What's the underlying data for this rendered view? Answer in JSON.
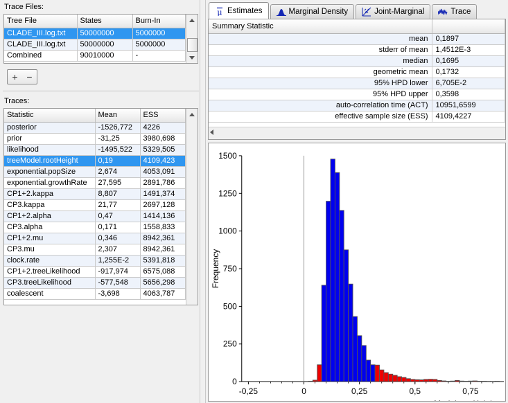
{
  "left_panel": {
    "trace_files_label": "Trace Files:",
    "trace_files_table": {
      "columns": [
        "Tree File",
        "States",
        "Burn-In"
      ],
      "rows": [
        {
          "file": "CLADE_III.log.txt",
          "states": "50000000",
          "burnin": "5000000",
          "selected": true
        },
        {
          "file": "CLADE_III.log.txt",
          "states": "50000000",
          "burnin": "5000000",
          "selected": false
        },
        {
          "file": "Combined",
          "states": "90010000",
          "burnin": "-",
          "selected": false
        }
      ]
    },
    "add_button_label": "+",
    "remove_button_label": "−",
    "traces_label": "Traces:",
    "traces_table": {
      "columns": [
        "Statistic",
        "Mean",
        "ESS"
      ],
      "rows": [
        {
          "statistic": "posterior",
          "mean": "-1526,772",
          "ess": "4226",
          "selected": false
        },
        {
          "statistic": "prior",
          "mean": "-31,25",
          "ess": "3980,698",
          "selected": false
        },
        {
          "statistic": "likelihood",
          "mean": "-1495,522",
          "ess": "5329,505",
          "selected": false
        },
        {
          "statistic": "treeModel.rootHeight",
          "mean": "0,19",
          "ess": "4109,423",
          "selected": true
        },
        {
          "statistic": "exponential.popSize",
          "mean": "2,674",
          "ess": "4053,091",
          "selected": false
        },
        {
          "statistic": "exponential.growthRate",
          "mean": "27,595",
          "ess": "2891,786",
          "selected": false
        },
        {
          "statistic": "CP1+2.kappa",
          "mean": "8,807",
          "ess": "1491,374",
          "selected": false
        },
        {
          "statistic": "CP3.kappa",
          "mean": "21,77",
          "ess": "2697,128",
          "selected": false
        },
        {
          "statistic": "CP1+2.alpha",
          "mean": "0,47",
          "ess": "1414,136",
          "selected": false
        },
        {
          "statistic": "CP3.alpha",
          "mean": "0,171",
          "ess": "1558,833",
          "selected": false
        },
        {
          "statistic": "CP1+2.mu",
          "mean": "0,346",
          "ess": "8942,361",
          "selected": false
        },
        {
          "statistic": "CP3.mu",
          "mean": "2,307",
          "ess": "8942,361",
          "selected": false
        },
        {
          "statistic": "clock.rate",
          "mean": "1,255E-2",
          "ess": "5391,818",
          "selected": false
        },
        {
          "statistic": "CP1+2.treeLikelihood",
          "mean": "-917,974",
          "ess": "6575,088",
          "selected": false
        },
        {
          "statistic": "CP3.treeLikelihood",
          "mean": "-577,548",
          "ess": "5656,298",
          "selected": false
        },
        {
          "statistic": "coalescent",
          "mean": "-3,698",
          "ess": "4063,787",
          "selected": false
        }
      ]
    }
  },
  "right_panel": {
    "tabs": [
      {
        "label": "Estimates",
        "icon": "mu-bar-icon",
        "active": true
      },
      {
        "label": "Marginal Density",
        "icon": "density-curve-icon",
        "active": false
      },
      {
        "label": "Joint-Marginal",
        "icon": "scatter-diagonal-icon",
        "active": false
      },
      {
        "label": "Trace",
        "icon": "trace-wave-icon",
        "active": false
      }
    ],
    "summary": {
      "header": "Summary Statistic",
      "header_value": "",
      "rows": [
        {
          "key": "mean",
          "value": "0,1897"
        },
        {
          "key": "stderr of mean",
          "value": "1,4512E-3"
        },
        {
          "key": "median",
          "value": "0,1695"
        },
        {
          "key": "geometric mean",
          "value": "0,1732"
        },
        {
          "key": "95% HPD lower",
          "value": "6,705E-2"
        },
        {
          "key": "95% HPD upper",
          "value": "0,3598"
        },
        {
          "key": "auto-correlation time (ACT)",
          "value": "10951,6599"
        },
        {
          "key": "effective sample size (ESS)",
          "value": "4109,4227"
        }
      ]
    }
  },
  "colors": {
    "selection_blue": "#2f96f0",
    "bar_blue": "#0000ee",
    "bar_red": "#ee0000",
    "bar_outline": "#555555",
    "tab_icon_blue": "#1427b4"
  },
  "chart_data": {
    "type": "bar",
    "title": "",
    "xlabel": "treeModel.rootHeight",
    "ylabel": "Frequency",
    "xlim": [
      -0.28,
      0.9
    ],
    "ylim": [
      0,
      1500
    ],
    "xticks": [
      -0.25,
      0,
      0.25,
      0.5,
      0.75
    ],
    "xticklabels": [
      "-0,25",
      "0",
      "0,25",
      "0,5",
      "0,75"
    ],
    "yticks": [
      0,
      250,
      500,
      750,
      1000,
      1250,
      1500
    ],
    "yticklabels": [
      "0",
      "250",
      "500",
      "750",
      "1000",
      "1250",
      "1500"
    ],
    "grid": false,
    "legend": false,
    "vertical_reference_line_x": 0,
    "bin_width": 0.02,
    "hpd_lower": 0.06705,
    "hpd_upper": 0.3598,
    "bar_colors": {
      "inside_hpd": "#0000ee",
      "outside_hpd": "#ee0000"
    },
    "bins": [
      {
        "x0": 0.02,
        "value": 3,
        "color": "red"
      },
      {
        "x0": 0.04,
        "value": 10,
        "color": "red"
      },
      {
        "x0": 0.06,
        "value": 112,
        "color": "red"
      },
      {
        "x0": 0.08,
        "value": 640,
        "color": "blue"
      },
      {
        "x0": 0.1,
        "value": 1198,
        "color": "blue"
      },
      {
        "x0": 0.12,
        "value": 1478,
        "color": "blue"
      },
      {
        "x0": 0.14,
        "value": 1388,
        "color": "blue"
      },
      {
        "x0": 0.16,
        "value": 1137,
        "color": "blue"
      },
      {
        "x0": 0.18,
        "value": 875,
        "color": "blue"
      },
      {
        "x0": 0.2,
        "value": 648,
        "color": "blue"
      },
      {
        "x0": 0.22,
        "value": 432,
        "color": "blue"
      },
      {
        "x0": 0.24,
        "value": 305,
        "color": "blue"
      },
      {
        "x0": 0.26,
        "value": 240,
        "color": "blue"
      },
      {
        "x0": 0.28,
        "value": 143,
        "color": "blue"
      },
      {
        "x0": 0.3,
        "value": 112,
        "color": "blue"
      },
      {
        "x0": 0.32,
        "value": 110,
        "color": "red"
      },
      {
        "x0": 0.34,
        "value": 78,
        "color": "red"
      },
      {
        "x0": 0.36,
        "value": 60,
        "color": "red"
      },
      {
        "x0": 0.38,
        "value": 50,
        "color": "red"
      },
      {
        "x0": 0.4,
        "value": 42,
        "color": "red"
      },
      {
        "x0": 0.42,
        "value": 33,
        "color": "red"
      },
      {
        "x0": 0.44,
        "value": 28,
        "color": "red"
      },
      {
        "x0": 0.46,
        "value": 20,
        "color": "red"
      },
      {
        "x0": 0.48,
        "value": 15,
        "color": "red"
      },
      {
        "x0": 0.5,
        "value": 13,
        "color": "red"
      },
      {
        "x0": 0.52,
        "value": 12,
        "color": "red"
      },
      {
        "x0": 0.54,
        "value": 15,
        "color": "red"
      },
      {
        "x0": 0.56,
        "value": 16,
        "color": "red"
      },
      {
        "x0": 0.58,
        "value": 15,
        "color": "red"
      },
      {
        "x0": 0.6,
        "value": 8,
        "color": "red"
      },
      {
        "x0": 0.62,
        "value": 5,
        "color": "red"
      },
      {
        "x0": 0.64,
        "value": 3,
        "color": "red"
      },
      {
        "x0": 0.66,
        "value": 4,
        "color": "red"
      },
      {
        "x0": 0.68,
        "value": 8,
        "color": "red"
      },
      {
        "x0": 0.7,
        "value": 4,
        "color": "red"
      },
      {
        "x0": 0.72,
        "value": 3,
        "color": "red"
      },
      {
        "x0": 0.74,
        "value": 4,
        "color": "red"
      },
      {
        "x0": 0.76,
        "value": 5,
        "color": "red"
      },
      {
        "x0": 0.78,
        "value": 3,
        "color": "red"
      },
      {
        "x0": 0.8,
        "value": 3,
        "color": "red"
      },
      {
        "x0": 0.82,
        "value": 2,
        "color": "red"
      },
      {
        "x0": 0.84,
        "value": 2,
        "color": "red"
      },
      {
        "x0": 0.86,
        "value": 3,
        "color": "red"
      }
    ]
  }
}
